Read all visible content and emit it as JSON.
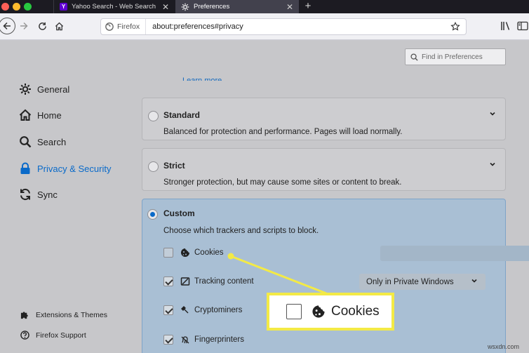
{
  "tabs": [
    {
      "title": "Yahoo Search - Web Search",
      "icon": "yahoo-icon",
      "icon_letter": "Y"
    },
    {
      "title": "Preferences",
      "icon": "gear-icon"
    }
  ],
  "urlbar": {
    "identity": "Firefox",
    "url": "about:preferences#privacy"
  },
  "find": {
    "placeholder": "Find in Preferences"
  },
  "sidebar": {
    "items": [
      {
        "label": "General",
        "icon": "gear-icon"
      },
      {
        "label": "Home",
        "icon": "home-icon"
      },
      {
        "label": "Search",
        "icon": "search-icon"
      },
      {
        "label": "Privacy & Security",
        "icon": "lock-icon",
        "selected": true
      },
      {
        "label": "Sync",
        "icon": "sync-icon"
      }
    ],
    "footer": [
      {
        "label": "Extensions & Themes",
        "icon": "puzzle-icon"
      },
      {
        "label": "Firefox Support",
        "icon": "help-icon"
      }
    ]
  },
  "learn_more": "Learn more",
  "protection": {
    "standard": {
      "title": "Standard",
      "desc": "Balanced for protection and performance. Pages will load normally."
    },
    "strict": {
      "title": "Strict",
      "desc": "Stronger protection, but may cause some sites or content to break."
    },
    "custom": {
      "title": "Custom",
      "desc": "Choose which trackers and scripts to block.",
      "options": [
        {
          "label": "Cookies",
          "checked": false,
          "icon": "cookie-icon"
        },
        {
          "label": "Tracking content",
          "checked": true,
          "icon": "tracking-icon",
          "select": "Only in Private Windows"
        },
        {
          "label": "Cryptominers",
          "checked": true,
          "icon": "cryptominer-icon"
        },
        {
          "label": "Fingerprinters",
          "checked": true,
          "icon": "fingerprint-icon"
        }
      ]
    }
  },
  "callout": {
    "label": "Cookies",
    "border_color": "#f3ea46"
  },
  "colors": {
    "accent": "#0a6ac9",
    "tabbar": "#1c1b22"
  },
  "watermark": "wsxdn.com"
}
